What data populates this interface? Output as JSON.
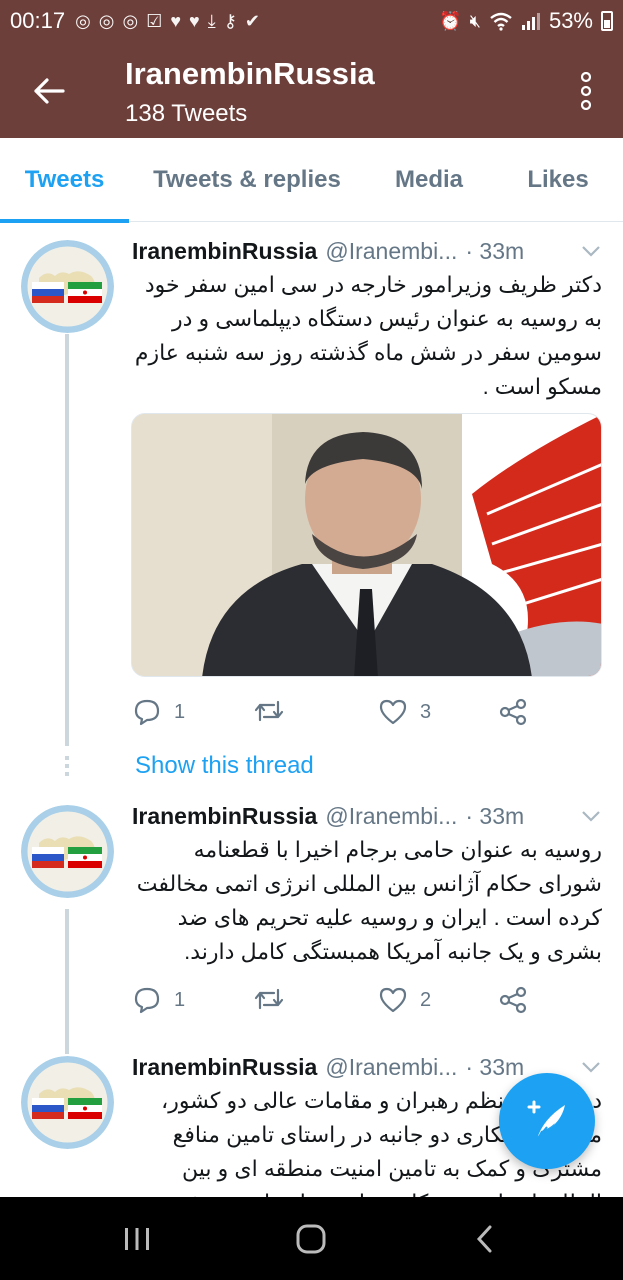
{
  "status_bar": {
    "time": "00:17",
    "battery": "53%",
    "notification_icons": [
      "instagram-icon",
      "instagram-icon",
      "instagram-icon",
      "checkbox-icon",
      "heart-icon",
      "heart-icon",
      "download-icon",
      "key-icon",
      "check-icon"
    ],
    "system_icons": [
      "alarm-icon",
      "mute-icon",
      "wifi-icon",
      "signal-icon",
      "battery-icon"
    ]
  },
  "app_bar": {
    "title": "IranembinRussia",
    "subtitle": "138 Tweets"
  },
  "tabs": [
    {
      "label": "Tweets",
      "active": true
    },
    {
      "label": "Tweets & replies",
      "active": false
    },
    {
      "label": "Media",
      "active": false
    },
    {
      "label": "Likes",
      "active": false
    }
  ],
  "tweets": [
    {
      "name": "IranembinRussia",
      "handle": "@Iranembi...",
      "time": "· 33m",
      "text": "دکتر ظریف وزیرامور خارجه در سی امین سفر خود به روسیه به عنوان رئیس دستگاه دیپلماسی و در سومین سفر در شش ماه گذشته روز سه شنبه عازم مسکو است .",
      "replies": "1",
      "retweets": "",
      "likes": "3",
      "show_thread": "Show this thread"
    },
    {
      "name": "IranembinRussia",
      "handle": "@Iranembi...",
      "time": "· 33m",
      "text": "روسیه به عنوان حامی برجام اخیرا با قطعنامه شورای حکام آژانس بین المللی انرژی اتمی مخالفت کرده است . ایران و روسیه علیه تحریم های ضد بشری و یک جانبه آمریکا همبستگی کامل دارند.",
      "replies": "1",
      "retweets": "",
      "likes": "2"
    },
    {
      "name": "IranembinRussia",
      "handle": "@Iranembi...",
      "time": "· 33m",
      "text": "دیدارهای منظم رهبران و مقامات عالی دو کشور، منجر به همکاری دو جانبه در راستای تامین منافع مشترک و کمک به تامین امنیت منطقه ای و بین المللی از طریق همکاری های منطقه ای می شود."
    }
  ],
  "colors": {
    "header_bg": "#6d3f3a",
    "accent": "#1da1f2",
    "secondary_text": "#657786"
  }
}
